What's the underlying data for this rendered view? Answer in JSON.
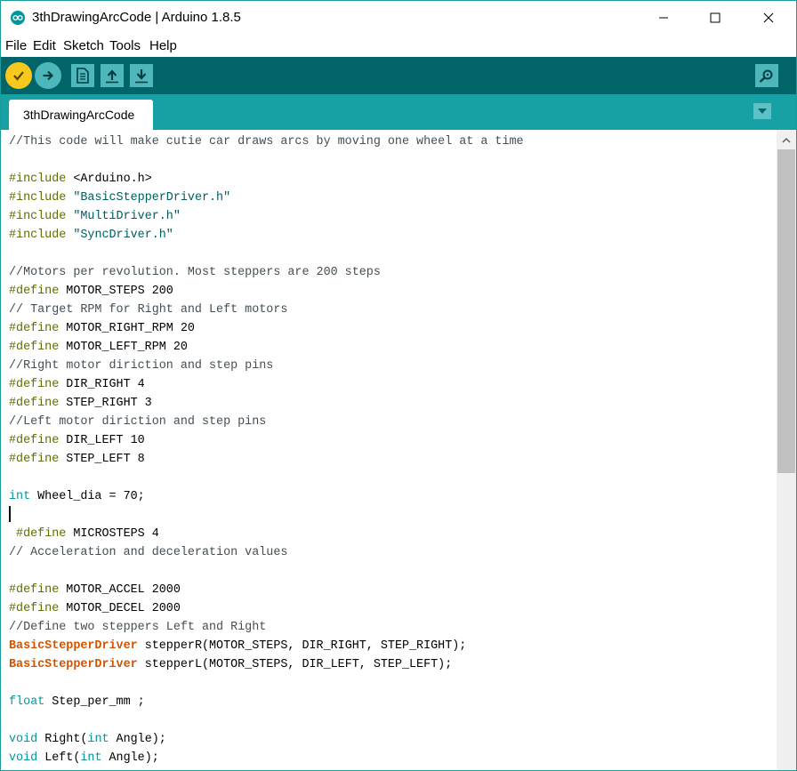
{
  "window": {
    "title": "3thDrawingArcCode | Arduino 1.8.5"
  },
  "menu": {
    "items": [
      "File",
      "Edit",
      "Sketch",
      "Tools",
      "Help"
    ]
  },
  "toolbar": {
    "buttons": [
      "verify-icon",
      "upload-icon",
      "new-icon",
      "open-icon",
      "save-icon"
    ],
    "serial_monitor": "serial-monitor-icon"
  },
  "tabs": {
    "active": "3thDrawingArcCode"
  },
  "editor": {
    "lines": [
      [
        [
          "comment",
          "//This code will make cutie car draws arcs by moving one wheel at a time"
        ]
      ],
      [],
      [
        [
          "directive",
          "#include"
        ],
        [
          "plain",
          " <Arduino.h>"
        ]
      ],
      [
        [
          "directive",
          "#include"
        ],
        [
          "plain",
          " "
        ],
        [
          "string",
          "\"BasicStepperDriver.h\""
        ]
      ],
      [
        [
          "directive",
          "#include"
        ],
        [
          "plain",
          " "
        ],
        [
          "string",
          "\"MultiDriver.h\""
        ]
      ],
      [
        [
          "directive",
          "#include"
        ],
        [
          "plain",
          " "
        ],
        [
          "string",
          "\"SyncDriver.h\""
        ]
      ],
      [],
      [
        [
          "comment",
          "//Motors per revolution. Most steppers are 200 steps"
        ]
      ],
      [
        [
          "directive",
          "#define"
        ],
        [
          "plain",
          " MOTOR_STEPS 200"
        ]
      ],
      [
        [
          "comment",
          "// Target RPM for Right and Left motors"
        ]
      ],
      [
        [
          "directive",
          "#define"
        ],
        [
          "plain",
          " MOTOR_RIGHT_RPM 20"
        ]
      ],
      [
        [
          "directive",
          "#define"
        ],
        [
          "plain",
          " MOTOR_LEFT_RPM 20"
        ]
      ],
      [
        [
          "comment",
          "//Right motor diriction and step pins"
        ]
      ],
      [
        [
          "directive",
          "#define"
        ],
        [
          "plain",
          " DIR_RIGHT 4"
        ]
      ],
      [
        [
          "directive",
          "#define"
        ],
        [
          "plain",
          " STEP_RIGHT 3"
        ]
      ],
      [
        [
          "comment",
          "//Left motor diriction and step pins"
        ]
      ],
      [
        [
          "directive",
          "#define"
        ],
        [
          "plain",
          " DIR_LEFT 10"
        ]
      ],
      [
        [
          "directive",
          "#define"
        ],
        [
          "plain",
          " STEP_LEFT 8"
        ]
      ],
      [],
      [
        [
          "kw",
          "int"
        ],
        [
          "plain",
          " Wheel_dia = 70;"
        ]
      ],
      [],
      [
        [
          "plain",
          " "
        ],
        [
          "directive",
          "#define"
        ],
        [
          "plain",
          " MICROSTEPS 4"
        ]
      ],
      [
        [
          "comment",
          "// Acceleration and deceleration values"
        ]
      ],
      [],
      [
        [
          "directive",
          "#define"
        ],
        [
          "plain",
          " MOTOR_ACCEL 2000"
        ]
      ],
      [
        [
          "directive",
          "#define"
        ],
        [
          "plain",
          " MOTOR_DECEL 2000"
        ]
      ],
      [
        [
          "comment",
          "//Define two steppers Left and Right"
        ]
      ],
      [
        [
          "type",
          "BasicStepperDriver"
        ],
        [
          "plain",
          " stepperR(MOTOR_STEPS, DIR_RIGHT, STEP_RIGHT);"
        ]
      ],
      [
        [
          "type",
          "BasicStepperDriver"
        ],
        [
          "plain",
          " stepperL(MOTOR_STEPS, DIR_LEFT, STEP_LEFT);"
        ]
      ],
      [],
      [
        [
          "kw",
          "float"
        ],
        [
          "plain",
          " Step_per_mm ;"
        ]
      ],
      [],
      [
        [
          "kw",
          "void"
        ],
        [
          "plain",
          " Right("
        ],
        [
          "kw",
          "int"
        ],
        [
          "plain",
          " Angle);"
        ]
      ],
      [
        [
          "kw",
          "void"
        ],
        [
          "plain",
          " Left("
        ],
        [
          "kw",
          "int"
        ],
        [
          "plain",
          " Angle);"
        ]
      ]
    ]
  },
  "colors": {
    "toolbar": "#006468",
    "tabbar": "#17a1a5",
    "verify": "#f8c81c",
    "comment": "#434f54",
    "directive": "#5e6d03",
    "string": "#005c5f",
    "keyword": "#00979c",
    "type": "#d35400"
  }
}
